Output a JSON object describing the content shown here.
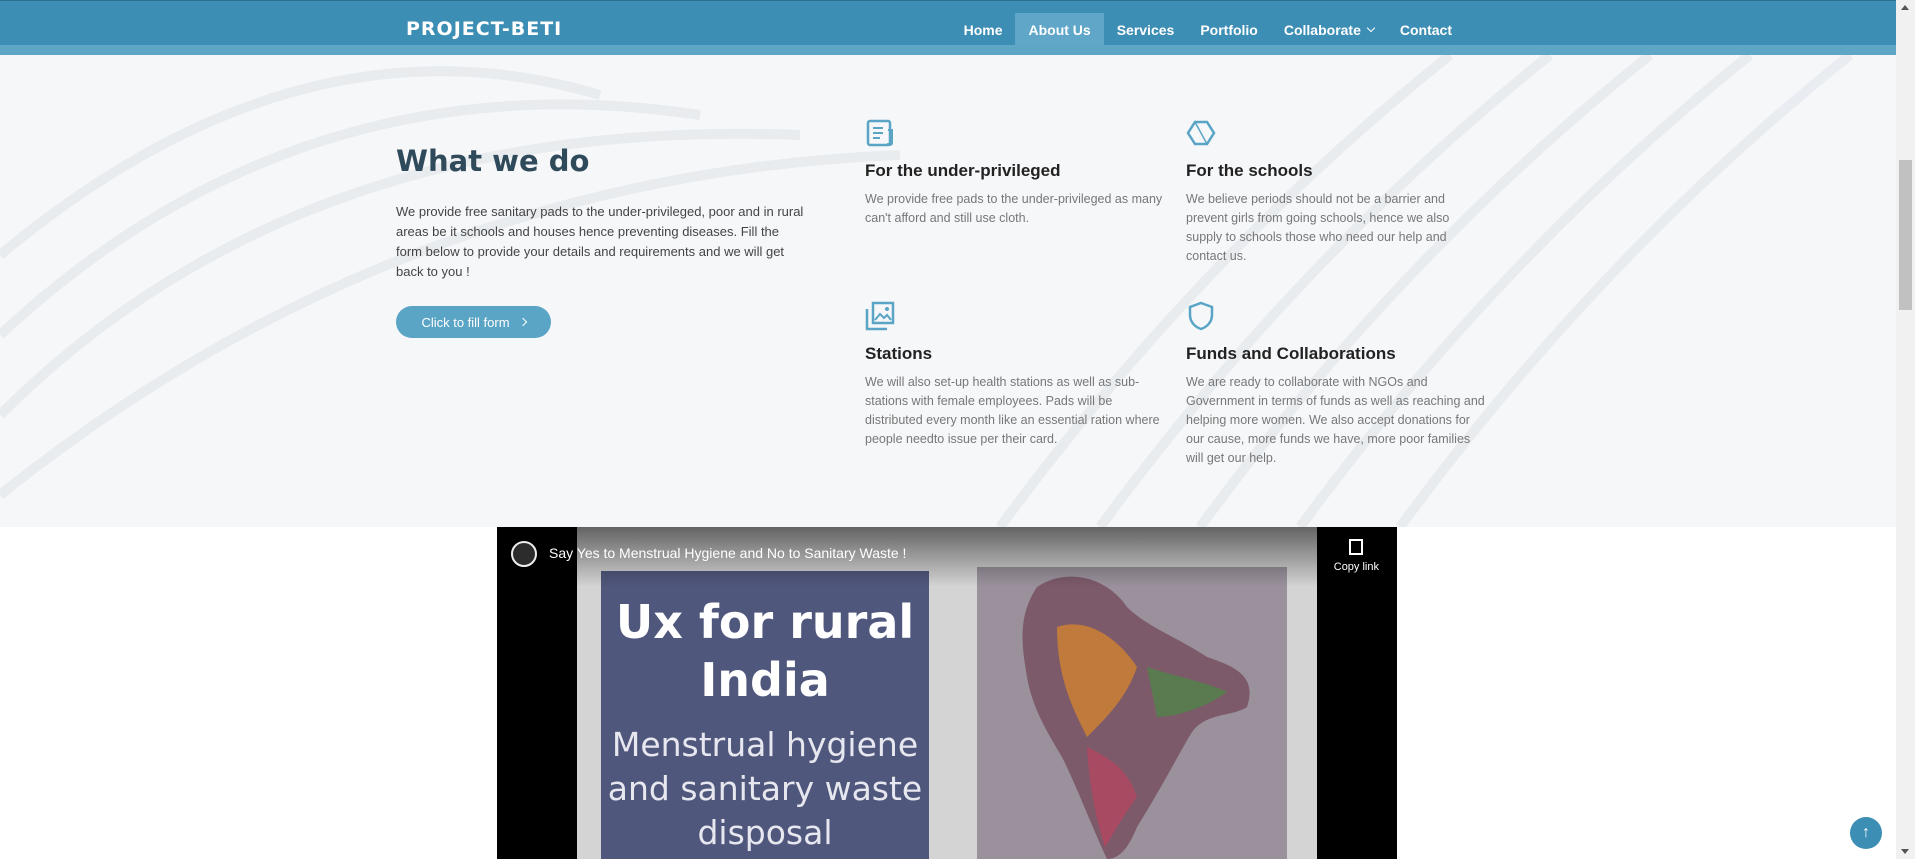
{
  "navbar": {
    "brand": "PROJECT-BETI",
    "items": [
      {
        "label": "Home"
      },
      {
        "label": "About Us"
      },
      {
        "label": "Services"
      },
      {
        "label": "Portfolio"
      },
      {
        "label": "Collaborate"
      },
      {
        "label": "Contact"
      }
    ]
  },
  "about": {
    "title": "What we do",
    "description": "We provide free sanitary pads to the under-privileged, poor and in rural areas be it schools and houses hence preventing diseases. Fill the form below to provide your details and requirements and we will get back to you !",
    "button_label": "Click to fill form",
    "cards": [
      {
        "icon": "document-icon",
        "title": "For the under-privileged",
        "text": "We provide free pads to the under-privileged as many can't afford and still use cloth."
      },
      {
        "icon": "cube-icon",
        "title": "For the schools",
        "text": "We believe periods should not be a barrier and prevent girls from going schools, hence we also supply to schools those who need our help and contact us."
      },
      {
        "icon": "images-icon",
        "title": "Stations",
        "text": "We will also set-up health stations as well as sub-stations with female employees. Pads will be distributed every month like an essential ration where people needto issue per their card."
      },
      {
        "icon": "shield-icon",
        "title": "Funds and Collaborations",
        "text": "We are ready to collaborate with NGOs and Government in terms of funds as well as reaching and helping more women. We also accept donations for our cause, more funds we have, more poor families will get our help."
      }
    ]
  },
  "video": {
    "title": "Say Yes to Menstrual Hygiene and No to Sanitary Waste !",
    "copy_label": "Copy link",
    "slide_heading": "Ux for rural India",
    "slide_sub": "Menstrual hygiene and sanitary waste disposal"
  },
  "colors": {
    "navbar": "#3d8eb5",
    "accent": "#5aa4c6"
  }
}
